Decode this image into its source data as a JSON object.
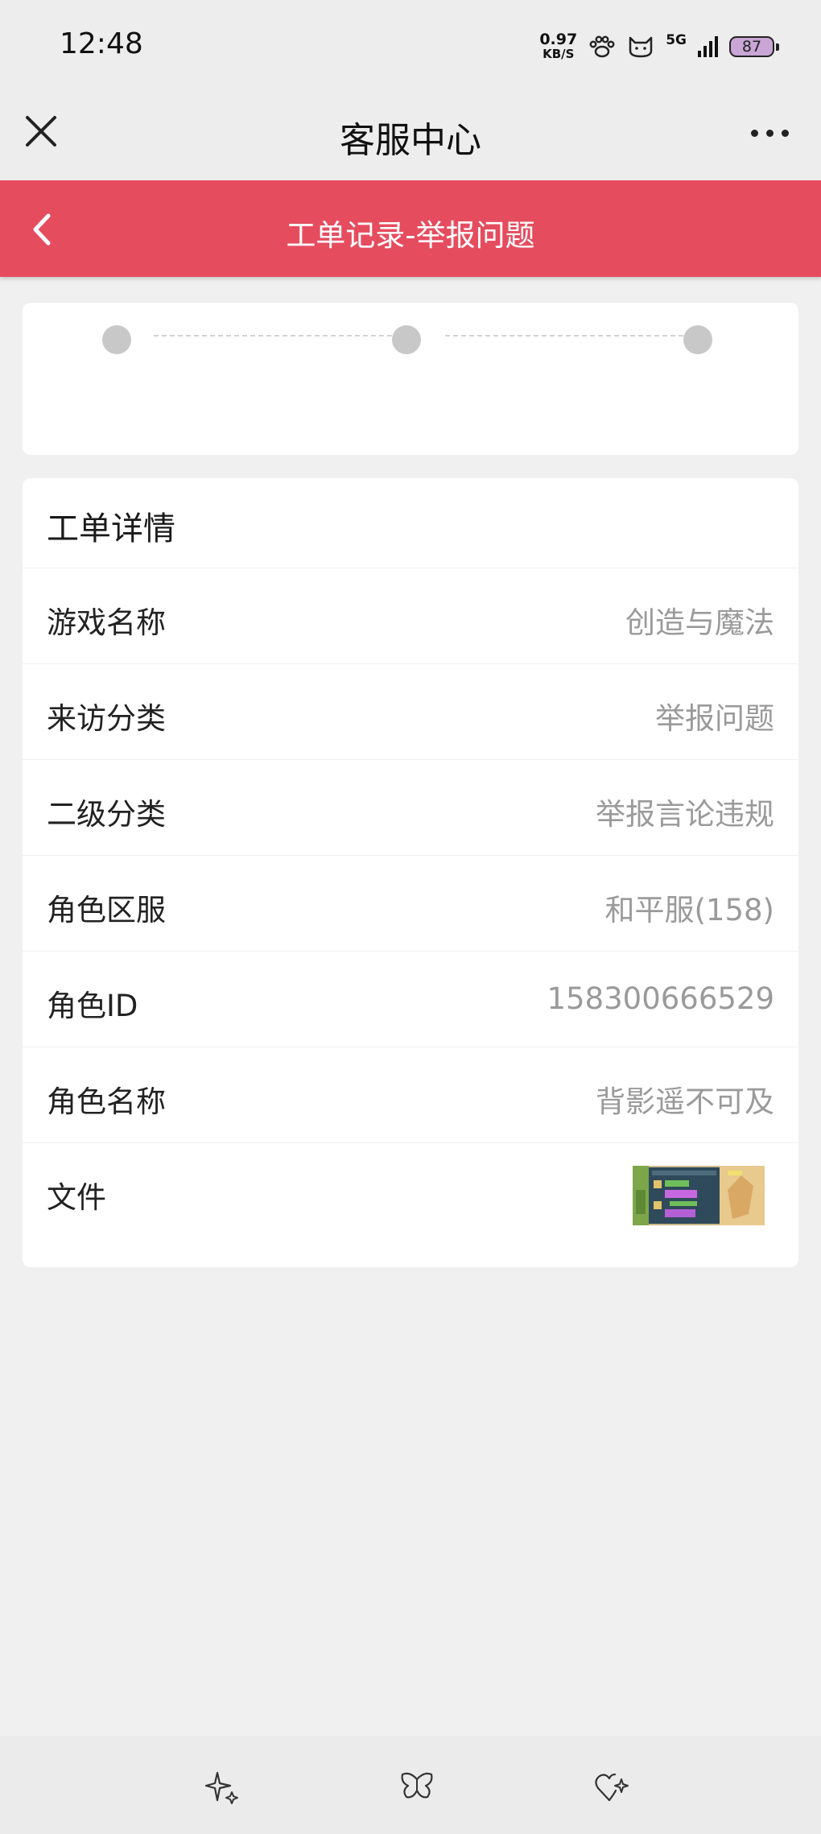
{
  "status_bar": {
    "time": "12:48",
    "net_speed_value": "0.97",
    "net_speed_unit": "KB/S",
    "network": "5G",
    "battery": "87",
    "icons": [
      "paw-icon",
      "cat-icon",
      "signal-icon",
      "battery-icon"
    ]
  },
  "nav": {
    "title": "客服中心",
    "close_icon": "close-icon",
    "more_icon": "more-icon"
  },
  "header": {
    "title": "工单记录-举报问题",
    "back_icon": "chevron-left-icon",
    "color": "#e54d5f"
  },
  "progress": {
    "steps": 3
  },
  "details": {
    "heading": "工单详情",
    "rows": [
      {
        "label": "游戏名称",
        "value": "创造与魔法"
      },
      {
        "label": "来访分类",
        "value": "举报问题"
      },
      {
        "label": "二级分类",
        "value": "举报言论违规"
      },
      {
        "label": "角色区服",
        "value": "和平服(158)"
      },
      {
        "label": "角色ID",
        "value": "158300666529"
      },
      {
        "label": "角色名称",
        "value": "背影遥不可及"
      }
    ],
    "file_label": "文件",
    "file_thumbnail": "game-screenshot-thumbnail"
  },
  "bottom_bar": {
    "icons": [
      "sparkle-icon",
      "butterfly-icon",
      "heart-sparkle-icon"
    ]
  }
}
